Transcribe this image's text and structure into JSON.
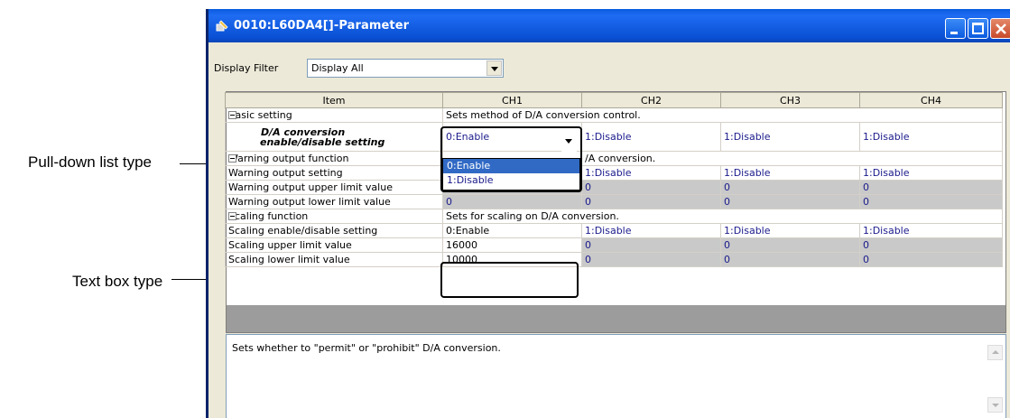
{
  "callouts": {
    "pulldown": "Pull-down list type",
    "textbox": "Text box type"
  },
  "window": {
    "title": "0010:L60DA4[]-Parameter",
    "filter_label": "Display Filter",
    "filter_value": "Display All"
  },
  "grid": {
    "headers": [
      "Item",
      "CH1",
      "CH2",
      "CH3",
      "CH4"
    ],
    "basic": {
      "label": "Basic setting",
      "desc": "Sets method of D/A conversion control.",
      "da_label_1": "D/A conversion",
      "da_label_2": "enable/disable setting",
      "da_values": [
        "0:Enable",
        "1:Disable",
        "1:Disable",
        "1:Disable"
      ]
    },
    "warning": {
      "label": "Warning output function",
      "desc_tail": "/A conversion.",
      "rows": [
        {
          "label": "Warning output setting",
          "values": [
            "",
            "1:Disable",
            "1:Disable",
            "1:Disable"
          ]
        },
        {
          "label": "Warning output upper limit value",
          "values": [
            "0",
            "0",
            "0",
            "0"
          ]
        },
        {
          "label": "Warning output lower limit value",
          "values": [
            "0",
            "0",
            "0",
            "0"
          ]
        }
      ]
    },
    "scaling": {
      "label": "Scaling function",
      "desc": "Sets for scaling on D/A conversion.",
      "rows": [
        {
          "label": "Scaling enable/disable setting",
          "values": [
            "0:Enable",
            "1:Disable",
            "1:Disable",
            "1:Disable"
          ]
        },
        {
          "label": "Scaling upper limit value",
          "values": [
            "16000",
            "0",
            "0",
            "0"
          ]
        },
        {
          "label": "Scaling lower limit value",
          "values": [
            "10000",
            "0",
            "0",
            "0"
          ]
        }
      ]
    },
    "dropdown_options": [
      "0:Enable",
      "1:Disable"
    ]
  },
  "description": "Sets whether to \"permit\" or \"prohibit\" D/A conversion.",
  "colors": {
    "titlebar": "#0950d4",
    "selection": "#316ac5",
    "value_text": "#1a1a8c",
    "disabled_cell": "#c9c9c9"
  }
}
